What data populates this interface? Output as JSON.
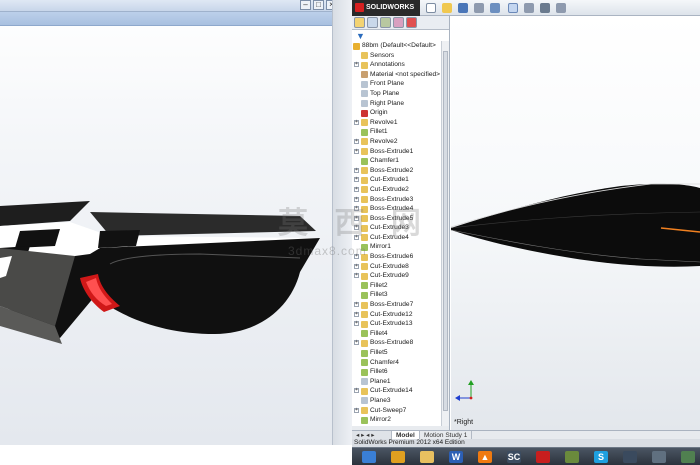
{
  "app": {
    "brand": "SOLIDWORKS",
    "status_text": "SolidWorks Premium 2012 x64 Edition"
  },
  "feature_tree": {
    "root": "88bm  (Default<<Default>",
    "items": [
      {
        "label": "Sensors",
        "icon": "sensors-icon",
        "expandable": false,
        "color": "#e8c35a"
      },
      {
        "label": "Annotations",
        "icon": "annotations-icon",
        "expandable": true,
        "color": "#e8c35a"
      },
      {
        "label": "Material <not specified>",
        "icon": "material-icon",
        "expandable": false,
        "color": "#c8a070"
      },
      {
        "label": "Front Plane",
        "icon": "plane-icon",
        "expandable": false,
        "color": "#b8c4d2"
      },
      {
        "label": "Top Plane",
        "icon": "plane-icon",
        "expandable": false,
        "color": "#b8c4d2"
      },
      {
        "label": "Right Plane",
        "icon": "plane-icon",
        "expandable": false,
        "color": "#b8c4d2"
      },
      {
        "label": "Origin",
        "icon": "origin-icon",
        "expandable": false,
        "color": "#cc3333"
      },
      {
        "label": "Revolve1",
        "icon": "revolve-icon",
        "expandable": true,
        "color": "#e8c35a"
      },
      {
        "label": "Fillet1",
        "icon": "fillet-icon",
        "expandable": false,
        "color": "#9ac25a"
      },
      {
        "label": "Revolve2",
        "icon": "revolve-icon",
        "expandable": true,
        "color": "#e8c35a"
      },
      {
        "label": "Boss-Extrude1",
        "icon": "boss-extrude-icon",
        "expandable": true,
        "color": "#e8c35a"
      },
      {
        "label": "Chamfer1",
        "icon": "chamfer-icon",
        "expandable": false,
        "color": "#9ac25a"
      },
      {
        "label": "Boss-Extrude2",
        "icon": "boss-extrude-icon",
        "expandable": true,
        "color": "#e8c35a"
      },
      {
        "label": "Cut-Extrude1",
        "icon": "cut-extrude-icon",
        "expandable": true,
        "color": "#e8c35a"
      },
      {
        "label": "Cut-Extrude2",
        "icon": "cut-extrude-icon",
        "expandable": true,
        "color": "#e8c35a"
      },
      {
        "label": "Boss-Extrude3",
        "icon": "boss-extrude-icon",
        "expandable": true,
        "color": "#e8c35a"
      },
      {
        "label": "Boss-Extrude4",
        "icon": "boss-extrude-icon",
        "expandable": true,
        "color": "#e8c35a"
      },
      {
        "label": "Boss-Extrude5",
        "icon": "boss-extrude-icon",
        "expandable": true,
        "color": "#e8c35a"
      },
      {
        "label": "Cut-Extrude3",
        "icon": "cut-extrude-icon",
        "expandable": true,
        "color": "#e8c35a"
      },
      {
        "label": "Cut-Extrude4",
        "icon": "cut-extrude-icon",
        "expandable": true,
        "color": "#e8c35a"
      },
      {
        "label": "Mirror1",
        "icon": "mirror-icon",
        "expandable": false,
        "color": "#9ac25a"
      },
      {
        "label": "Boss-Extrude6",
        "icon": "boss-extrude-icon",
        "expandable": true,
        "color": "#e8c35a"
      },
      {
        "label": "Cut-Extrude8",
        "icon": "cut-extrude-icon",
        "expandable": true,
        "color": "#e8c35a"
      },
      {
        "label": "Cut-Extrude9",
        "icon": "cut-extrude-icon",
        "expandable": true,
        "color": "#e8c35a"
      },
      {
        "label": "Fillet2",
        "icon": "fillet-icon",
        "expandable": false,
        "color": "#9ac25a"
      },
      {
        "label": "Fillet3",
        "icon": "fillet-icon",
        "expandable": false,
        "color": "#9ac25a"
      },
      {
        "label": "Boss-Extrude7",
        "icon": "boss-extrude-icon",
        "expandable": true,
        "color": "#e8c35a"
      },
      {
        "label": "Cut-Extrude12",
        "icon": "cut-extrude-icon",
        "expandable": true,
        "color": "#e8c35a"
      },
      {
        "label": "Cut-Extrude13",
        "icon": "cut-extrude-icon",
        "expandable": true,
        "color": "#e8c35a"
      },
      {
        "label": "Fillet4",
        "icon": "fillet-icon",
        "expandable": false,
        "color": "#9ac25a"
      },
      {
        "label": "Boss-Extrude8",
        "icon": "boss-extrude-icon",
        "expandable": true,
        "color": "#e8c35a"
      },
      {
        "label": "Fillet5",
        "icon": "fillet-icon",
        "expandable": false,
        "color": "#9ac25a"
      },
      {
        "label": "Chamfer4",
        "icon": "chamfer-icon",
        "expandable": false,
        "color": "#9ac25a"
      },
      {
        "label": "Fillet6",
        "icon": "fillet-icon",
        "expandable": false,
        "color": "#9ac25a"
      },
      {
        "label": "Plane1",
        "icon": "plane-icon",
        "expandable": false,
        "color": "#b8c4d2"
      },
      {
        "label": "Cut-Extrude14",
        "icon": "cut-extrude-icon",
        "expandable": true,
        "color": "#e8c35a"
      },
      {
        "label": "Plane3",
        "icon": "plane-icon",
        "expandable": false,
        "color": "#b8c4d2"
      },
      {
        "label": "Cut-Sweep7",
        "icon": "cut-sweep-icon",
        "expandable": true,
        "color": "#e8c35a"
      },
      {
        "label": "Mirror2",
        "icon": "mirror-icon",
        "expandable": false,
        "color": "#9ac25a"
      }
    ]
  },
  "tabs": [
    {
      "label": "Model",
      "active": true
    },
    {
      "label": "Motion Study 1",
      "active": false
    }
  ],
  "viewport": {
    "view_label": "*Right"
  },
  "watermark": {
    "chinese": "莫 西 网",
    "url": "3dmax8.com"
  },
  "taskbar": {
    "items": [
      {
        "name": "start-button-icon",
        "glyph": "",
        "color": "#3a7fd5"
      },
      {
        "name": "chrome-icon",
        "glyph": "",
        "color": "#e0a020"
      },
      {
        "name": "folder-icon",
        "glyph": "",
        "color": "#e8c060"
      },
      {
        "name": "word-icon",
        "glyph": "W",
        "color": "#2b5fb5"
      },
      {
        "name": "vlc-icon",
        "glyph": "▲",
        "color": "#f07a10"
      },
      {
        "name": "app-icon",
        "glyph": "SC",
        "color": "#3c4c60"
      },
      {
        "name": "solidworks-icon",
        "glyph": "",
        "color": "#c81e1e"
      },
      {
        "name": "minecraft-icon",
        "glyph": "",
        "color": "#6a8a3c"
      },
      {
        "name": "skype-icon",
        "glyph": "S",
        "color": "#1ea0e0"
      },
      {
        "name": "steam-icon",
        "glyph": "",
        "color": "#3a4a5e"
      },
      {
        "name": "monitor-icon",
        "glyph": "",
        "color": "#607080"
      },
      {
        "name": "misc-icon",
        "glyph": "",
        "color": "#508050"
      }
    ]
  }
}
